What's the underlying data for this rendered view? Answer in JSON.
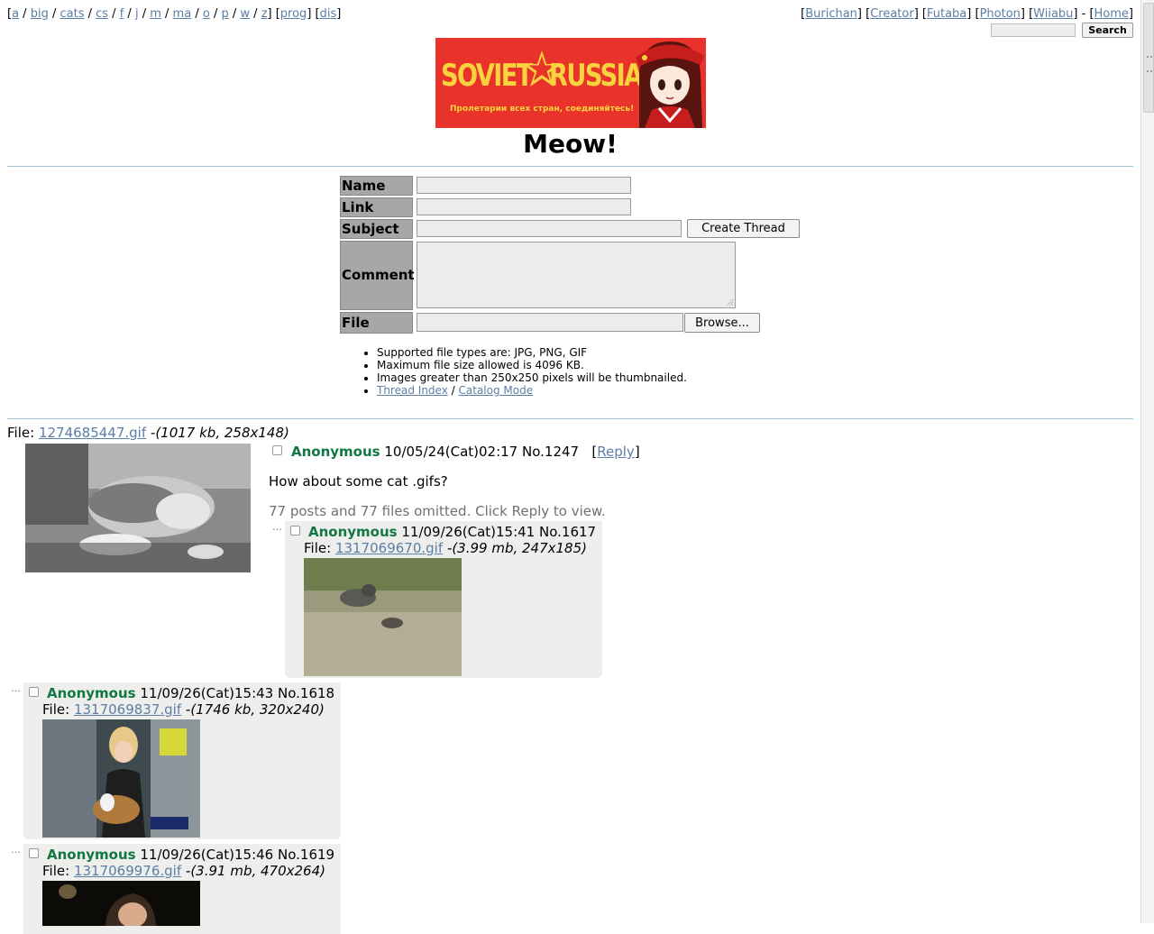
{
  "nav": {
    "boards": [
      "a",
      "big",
      "cats",
      "cs",
      "f",
      "j",
      "m",
      "ma",
      "o",
      "p",
      "w",
      "z"
    ],
    "extra": [
      "prog",
      "dis"
    ],
    "styles": [
      "Burichan",
      "Creator",
      "Futaba",
      "Photon",
      "Wiiabu"
    ],
    "home": "Home",
    "search_button": "Search"
  },
  "banner": {
    "left_word": "SOVIET",
    "right_word": "RUSSIA",
    "motto": "Пролетарии всех стран, соединяйтесь!"
  },
  "board": {
    "title": "Meow!"
  },
  "form": {
    "name_label": "Name",
    "link_label": "Link",
    "subject_label": "Subject",
    "comment_label": "Comment",
    "file_label": "File",
    "submit_label": "Create Thread",
    "browse_label": "Browse..."
  },
  "rules": {
    "types": "Supported file types are: JPG, PNG, GIF",
    "maxsize": "Maximum file size allowed is 4096 KB.",
    "thumb": "Images greater than 250x250 pixels will be thumbnailed.",
    "thread_index": "Thread Index",
    "separator": "/",
    "catalog": "Catalog Mode"
  },
  "op": {
    "file_prefix": "File:",
    "file_name": "1274685447.gif",
    "file_info": "-(1017 kb, 258x148)",
    "name": "Anonymous",
    "date": "10/05/24(Cat)02:17",
    "number": "No.1247",
    "reply_open": "[",
    "reply_label": "Reply",
    "reply_close": "]",
    "comment": "How about some cat .gifs?",
    "omitted": "77 posts and 77 files omitted. Click Reply to view."
  },
  "replies": [
    {
      "name": "Anonymous",
      "date": "11/09/26(Cat)15:41",
      "number": "No.1617",
      "file_prefix": "File:",
      "file_name": "1317069670.gif",
      "file_info": "-(3.99 mb, 247x185)"
    },
    {
      "name": "Anonymous",
      "date": "11/09/26(Cat)15:43",
      "number": "No.1618",
      "file_prefix": "File:",
      "file_name": "1317069837.gif",
      "file_info": "-(1746 kb, 320x240)"
    },
    {
      "name": "Anonymous",
      "date": "11/09/26(Cat)15:46",
      "number": "No.1619",
      "file_prefix": "File:",
      "file_name": "1317069976.gif",
      "file_info": "-(3.91 mb, 470x264)"
    }
  ],
  "colors": {
    "poster": "#117743",
    "link": "#5b7ea6",
    "reply_bg": "#eeeeec",
    "label_bg": "#a7a7a7",
    "banner": "#e8322a"
  }
}
